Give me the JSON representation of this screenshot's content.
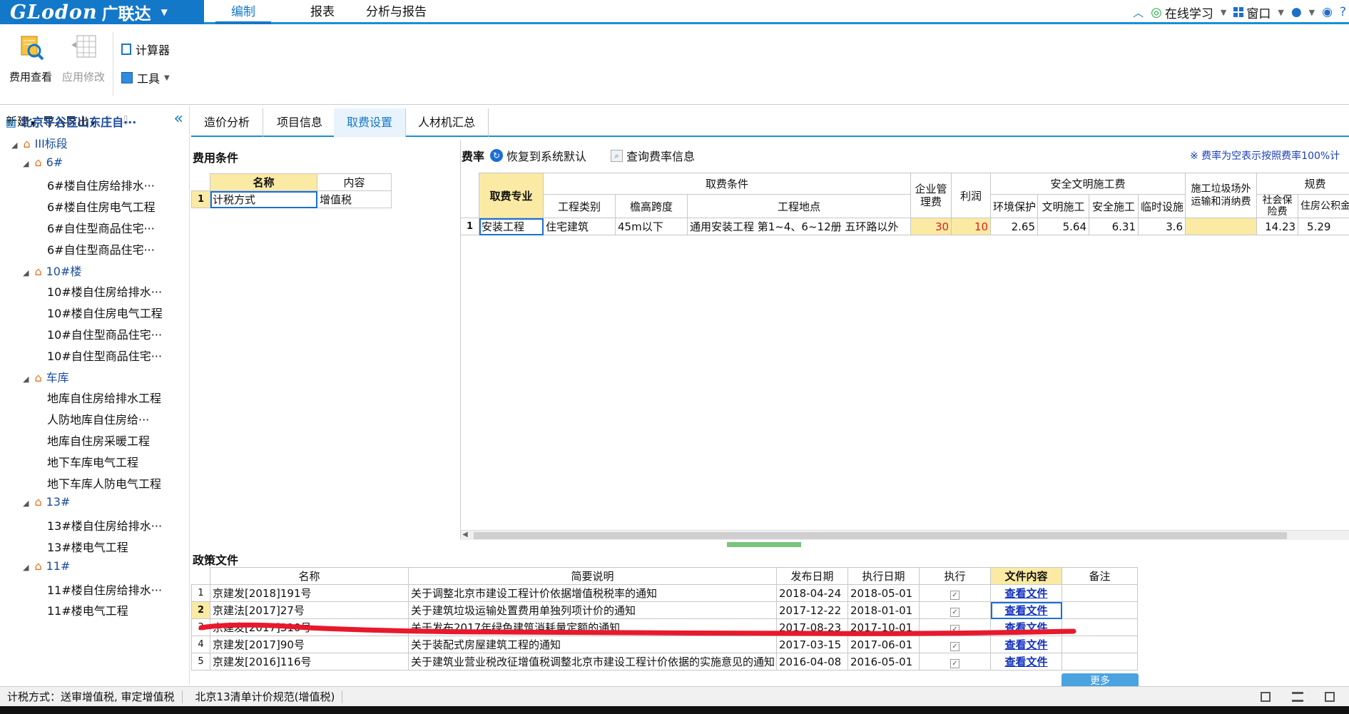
{
  "app": {
    "brand": "GLodon",
    "brand_cn": "广联达"
  },
  "menu_tabs": [
    "编制",
    "报表",
    "分析与报告"
  ],
  "top_right": {
    "online_learning": "在线学习",
    "window": "窗口"
  },
  "ribbon": {
    "fee_view": "费用查看",
    "apply_modify": "应用修改",
    "calculator": "计算器",
    "tools": "工具"
  },
  "left_toolbar": {
    "new": "新建",
    "import_export": "导入导出"
  },
  "tree": {
    "root": "北京平谷区山东庄自···",
    "section": "III标段",
    "groups": [
      {
        "name": "6#",
        "items": [
          "6#楼自住房给排水···",
          "6#楼自住房电气工程",
          "6#自住型商品住宅···",
          "6#自住型商品住宅···"
        ]
      },
      {
        "name": "10#楼",
        "items": [
          "10#楼自住房给排水···",
          "10#楼自住房电气工程",
          "10#自住型商品住宅···",
          "10#自住型商品住宅···"
        ]
      },
      {
        "name": "车库",
        "items": [
          "地库自住房给排水工程",
          "人防地库自住房给···",
          "地库自住房采暖工程",
          "地下车库电气工程",
          "地下车库人防电气工程"
        ]
      },
      {
        "name": "13#",
        "items": [
          "13#楼自住房给排水···",
          "13#楼电气工程"
        ]
      },
      {
        "name": "11#",
        "items": [
          "11#楼自住房给排水···",
          "11#楼电气工程"
        ]
      }
    ]
  },
  "sub_tabs": [
    "造价分析",
    "项目信息",
    "取费设置",
    "人材机汇总"
  ],
  "fee_conditions": {
    "title": "费用条件",
    "headers": [
      "名称",
      "内容"
    ],
    "rows": [
      {
        "no": "1",
        "name": "计税方式",
        "content": "增值税"
      }
    ]
  },
  "fee_rates": {
    "title": "费率",
    "restore_default": "恢复到系统默认",
    "query_info": "查询费率信息",
    "note": "※ 费率为空表示按照费率100%计",
    "headers": {
      "specialty": "取费专业",
      "conditions": "取费条件",
      "project_type": "工程类别",
      "eave_span": "檐高跨度",
      "location": "工程地点",
      "mgmt_fee": "企业管理费",
      "profit": "利润",
      "safety": "安全文明施工费",
      "env": "环境保护",
      "civil": "文明施工",
      "safe": "安全施工",
      "temp": "临时设施",
      "waste": "施工垃圾场外运输和消纳费",
      "regulation": "规费",
      "social": "社会保险费",
      "housing": "住房公积金"
    },
    "row": {
      "no": "1",
      "specialty": "安装工程",
      "project_type": "住宅建筑",
      "eave_span": "45m以下",
      "location": "通用安装工程 第1~4、6~12册 五环路以外",
      "mgmt_fee": "30",
      "profit": "10",
      "env": "2.65",
      "civil": "5.64",
      "safe": "6.31",
      "temp": "3.6",
      "waste": "",
      "social": "14.23",
      "housing": "5.29"
    }
  },
  "policy": {
    "title": "政策文件",
    "headers": [
      "名称",
      "简要说明",
      "发布日期",
      "执行日期",
      "执行",
      "文件内容",
      "备注"
    ],
    "rows": [
      {
        "no": "1",
        "name": "京建发[2018]191号",
        "desc": "关于调整北京市建设工程计价依据增值税税率的通知",
        "pub": "2018-04-24",
        "exec": "2018-05-01",
        "check": "✓",
        "link": "查看文件"
      },
      {
        "no": "2",
        "name": "京建法[2017]27号",
        "desc": "关于建筑垃圾运输处置费用单独列项计价的通知",
        "pub": "2017-12-22",
        "exec": "2018-01-01",
        "check": "✓",
        "link": "查看文件"
      },
      {
        "no": "3",
        "name": "京建发[2017]310号",
        "desc": "关于发布2017年绿色建筑消耗量定额的通知",
        "pub": "2017-08-23",
        "exec": "2017-10-01",
        "check": "✓",
        "link": "查看文件"
      },
      {
        "no": "4",
        "name": "京建发[2017]90号",
        "desc": "关于装配式房屋建筑工程的通知",
        "pub": "2017-03-15",
        "exec": "2017-06-01",
        "check": "✓",
        "link": "查看文件"
      },
      {
        "no": "5",
        "name": "京建发[2016]116号",
        "desc": "关于建筑业营业税改征增值税调整北京市建设工程计价依据的实施意见的通知",
        "pub": "2016-04-08",
        "exec": "2016-05-01",
        "check": "✓",
        "link": "查看文件"
      }
    ],
    "more": "更多"
  },
  "status": {
    "tax_mode": "计税方式：送审增值税, 审定增值税",
    "spec": "北京13清单计价规范(增值税)"
  },
  "colors": {
    "brand": "#1478c8",
    "accent": "#1a8fd6",
    "header_yellow": "#fbeaa3",
    "annotation_red": "#e8192c"
  }
}
